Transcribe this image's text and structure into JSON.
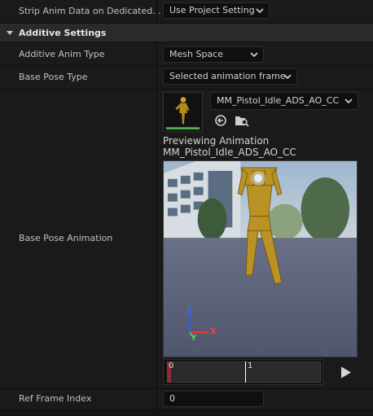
{
  "rows": {
    "strip_anim": {
      "label": "Strip Anim Data on Dedicated...",
      "value": "Use Project Setting"
    },
    "additive_anim_type": {
      "label": "Additive Anim Type",
      "value": "Mesh Space"
    },
    "base_pose_type": {
      "label": "Base Pose Type",
      "value": "Selected animation frame"
    },
    "base_pose_animation": {
      "label": "Base Pose Animation",
      "asset": "MM_Pistol_Idle_ADS_AO_CC",
      "previewing_line1": "Previewing Animation",
      "previewing_line2": "MM_Pistol_Idle_ADS_AO_CC",
      "timeline_start": "0",
      "timeline_mark": "1"
    },
    "ref_frame_index": {
      "label": "Ref Frame Index",
      "value": "0"
    }
  },
  "section": {
    "title": "Additive Settings"
  },
  "axes": {
    "x": "X",
    "y": "Y",
    "z": "Z"
  },
  "icons": [
    "chevron-down-icon",
    "collapse-arrow-icon",
    "browse-back-icon",
    "find-in-browser-icon",
    "play-icon"
  ],
  "colors": {
    "accent_gold": "#b08a1a",
    "viewport_floor": "#596079"
  }
}
